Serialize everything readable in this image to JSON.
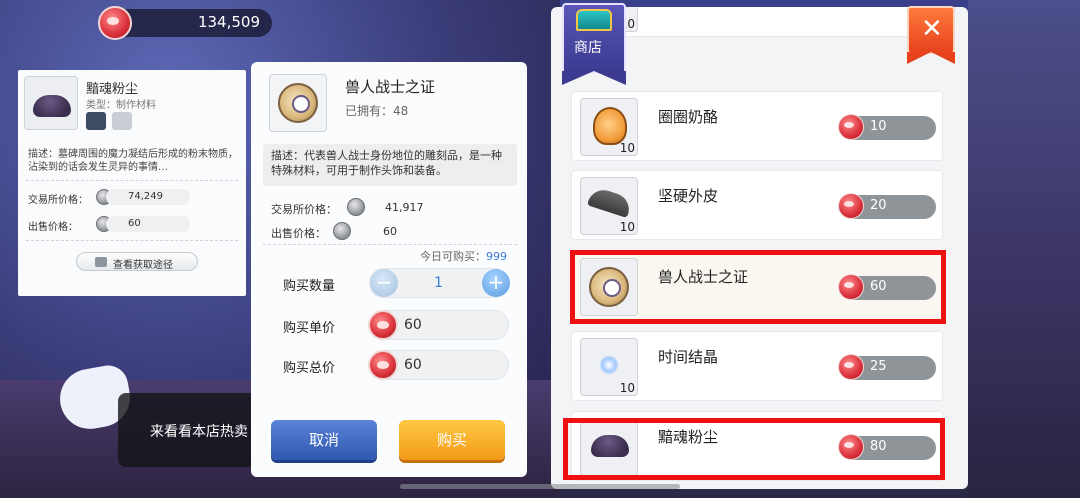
{
  "currency": {
    "amount": "134,509"
  },
  "info_card": {
    "name": "黯魂粉尘",
    "type": "类型：制作材料",
    "description": "描述：墓碑周围的魔力凝结后形成的粉末物质，沾染到的话会发生灵异的事情…",
    "exchange_label": "交易所价格：",
    "exchange_value": "74,249",
    "sell_label": "出售价格：",
    "sell_value": "60",
    "route_button": "查看获取途径"
  },
  "toast": {
    "text": "来看看本店热卖"
  },
  "purchase": {
    "name": "兽人战士之证",
    "owned": "已拥有：48",
    "description": "描述：代表兽人战士身份地位的雕刻品，是一种特殊材料，可用于制作头饰和装备。",
    "exchange_label": "交易所价格：",
    "exchange_value": "41,917",
    "sell_label": "出售价格：",
    "sell_value": "60",
    "today_label": "今日可购买：",
    "today_value": "999",
    "quantity_label": "购买数量",
    "quantity_value": "1",
    "unit_price_label": "购买单价",
    "unit_price_value": "60",
    "total_price_label": "购买总价",
    "total_price_value": "60",
    "cancel_label": "取消",
    "buy_label": "购买"
  },
  "shop": {
    "tab_label": "商店",
    "close_label": "✕",
    "partial_qty": "10",
    "items": [
      {
        "name": "圈圈奶酪",
        "qty": "10",
        "price": "10",
        "icon": "cheese-icon"
      },
      {
        "name": "坚硬外皮",
        "qty": "10",
        "price": "20",
        "icon": "hide-icon"
      },
      {
        "name": "兽人战士之证",
        "qty": "",
        "price": "60",
        "icon": "badge-icon"
      },
      {
        "name": "时间结晶",
        "qty": "10",
        "price": "25",
        "icon": "crystal-icon"
      },
      {
        "name": "黯魂粉尘",
        "qty": "",
        "price": "80",
        "icon": "dust-icon"
      }
    ]
  },
  "colors": {
    "highlight": "#ee1111",
    "buy_button": "#f29a16",
    "cancel_button": "#2f57ad"
  }
}
